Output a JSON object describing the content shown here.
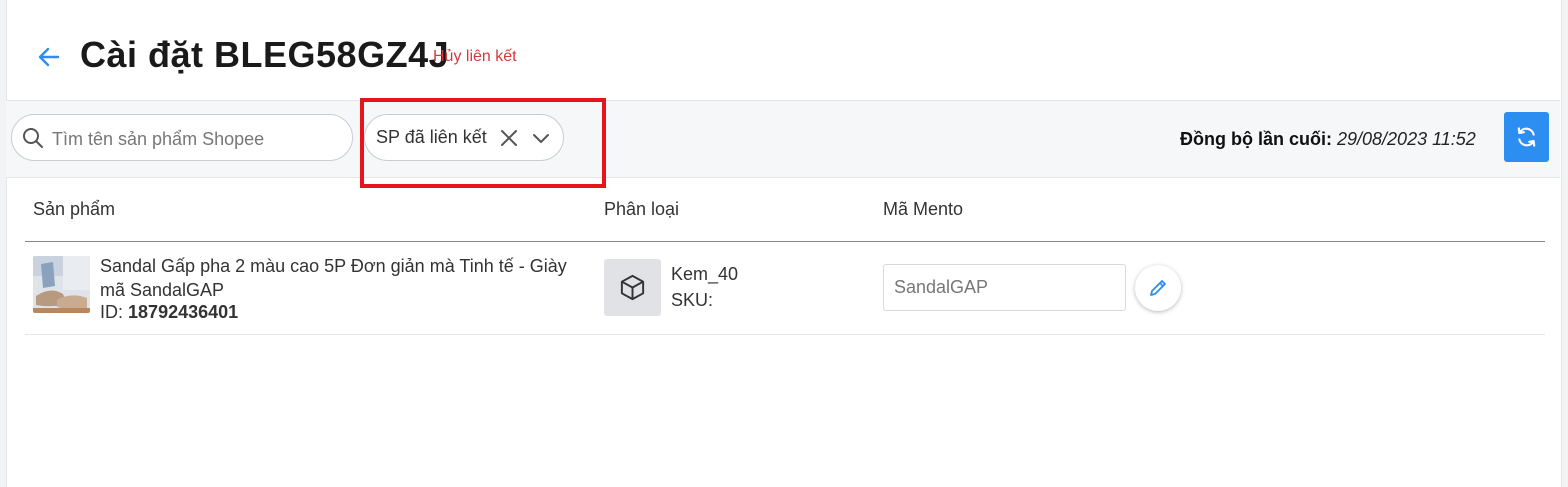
{
  "header": {
    "title": "Cài đặt BLEG58GZ4J",
    "unlink_label": "Hủy liên kết"
  },
  "toolbar": {
    "search_placeholder": "Tìm tên sản phẩm Shopee",
    "filter_value": "SP đã liên kết",
    "sync_label": "Đồng bộ lần cuối:",
    "sync_time": "29/08/2023 11:52"
  },
  "table": {
    "columns": [
      "Sản phẩm",
      "Phân loại",
      "Mã Mento"
    ],
    "rows": [
      {
        "product_name": "Sandal Gấp pha 2 màu cao 5P Đơn giản mà Tinh tế - Giày mã SandalGAP",
        "id_label": "ID:",
        "id_value": "18792436401",
        "variant_name": "Kem_40",
        "sku_label": "SKU:",
        "mento_code": "SandalGAP"
      }
    ]
  },
  "colors": {
    "accent": "#2c8ef0",
    "danger": "#d33a3a",
    "highlight": "#e8141c"
  },
  "icons": {
    "back": "arrow-left-icon",
    "search": "search-icon",
    "clear": "close-icon",
    "dropdown": "chevron-down-icon",
    "sync": "refresh-icon",
    "variant": "box-icon",
    "edit": "pencil-icon"
  }
}
